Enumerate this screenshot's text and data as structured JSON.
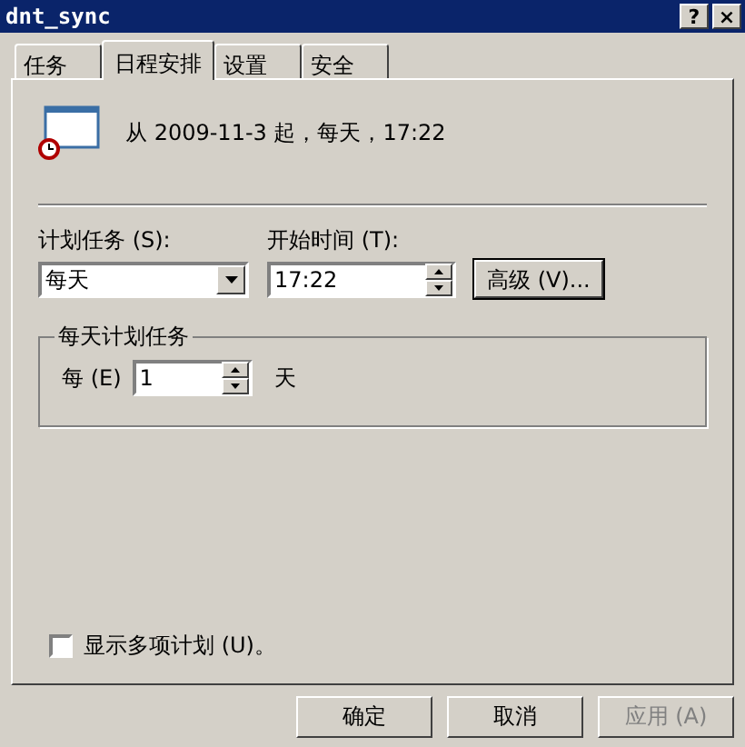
{
  "window": {
    "title": "dnt_sync",
    "title_buttons": [
      "?",
      "×"
    ]
  },
  "tabs": [
    {
      "label": "任务",
      "selected": false
    },
    {
      "label": "日程安排",
      "selected": true
    },
    {
      "label": "设置",
      "selected": false
    },
    {
      "label": "安全",
      "selected": false
    }
  ],
  "summary": "从 2009-11-3 起，每天，17:22",
  "schedule": {
    "label": "计划任务 (S):",
    "value": "每天"
  },
  "start_time": {
    "label": "开始时间 (T):",
    "value": "17:22"
  },
  "advanced_button": "高级 (V)...",
  "group": {
    "title": "每天计划任务",
    "every_label": "每 (E)",
    "every_value": "1",
    "unit": "天"
  },
  "show_multiple": {
    "label": "显示多项计划 (U)。",
    "checked": false
  },
  "buttons": [
    {
      "label": "确定",
      "disabled": false
    },
    {
      "label": "取消",
      "disabled": false
    },
    {
      "label": "应用 (A)",
      "disabled": true
    }
  ]
}
